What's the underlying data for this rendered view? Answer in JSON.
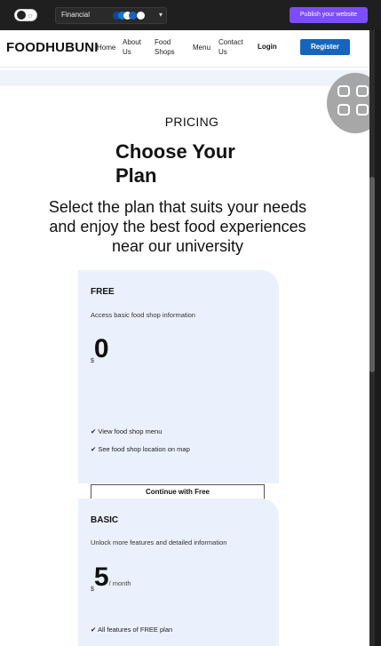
{
  "editor": {
    "theme_label": "Financial",
    "theme_chevron": "▾",
    "toggle_icon": "☼",
    "publish_label": "Publish your website",
    "accent": "#7c4dff"
  },
  "site": {
    "logo": "FOODHUBUNI",
    "nav": {
      "home": "Home",
      "about_1": "About",
      "about_2": "Us",
      "food_1": "Food",
      "food_2": "Shops",
      "menu": "Menu",
      "contact_1": "Contact",
      "contact_2": "Us",
      "login": "Login",
      "register": "Register"
    },
    "brand_color": "#1565c0"
  },
  "pricing": {
    "label": "PRICING",
    "heading_1": "Choose Your",
    "heading_2": "Plan",
    "sub_1": "Select the plan that suits your needs",
    "sub_2": "and enjoy the best food experiences",
    "sub_3": "near our university",
    "plans": [
      {
        "title": "FREE",
        "desc": "Access basic food shop information",
        "currency": "$",
        "amount": "0",
        "period": "",
        "features": [
          "✔ View food shop menu",
          "✔ See food shop location on map"
        ],
        "cta": "Continue with Free"
      },
      {
        "title": "BASIC",
        "desc": "Unlock more features and detailed information",
        "currency": "$",
        "amount": "5",
        "period": "/ month",
        "features": [
          "✔ All features of FREE plan"
        ]
      }
    ]
  }
}
